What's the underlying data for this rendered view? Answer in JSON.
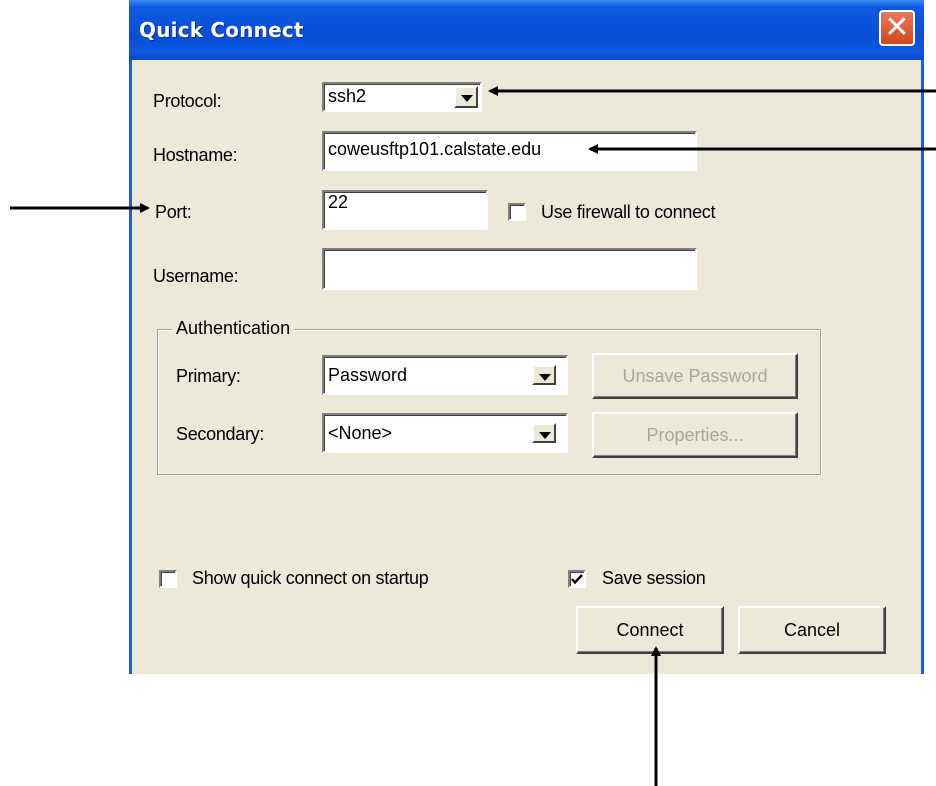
{
  "window": {
    "title": "Quick Connect",
    "close_glyph": "✕"
  },
  "form": {
    "protocol": {
      "label": "Protocol:",
      "value": "ssh2"
    },
    "hostname": {
      "label": "Hostname:",
      "value": "coweusftp101.calstate.edu"
    },
    "port": {
      "label": "Port:",
      "value": "22"
    },
    "firewall": {
      "label": "Use firewall to connect",
      "checked": false
    },
    "username": {
      "label": "Username:",
      "value": ""
    }
  },
  "authentication": {
    "title": "Authentication",
    "primary": {
      "label": "Primary:",
      "value": "Password"
    },
    "secondary": {
      "label": "Secondary:",
      "value": "<None>"
    },
    "unsave_password_button": "Unsave Password",
    "properties_button": "Properties..."
  },
  "footer": {
    "show_quick_connect": {
      "label": "Show quick connect on startup",
      "checked": false
    },
    "save_session": {
      "label": "Save session",
      "checked": true
    },
    "connect_button": "Connect",
    "cancel_button": "Cancel"
  },
  "colors": {
    "titlebar": "#0a4fd6",
    "dialog_bg": "#ece9d8",
    "close_button": "#d2461f"
  }
}
